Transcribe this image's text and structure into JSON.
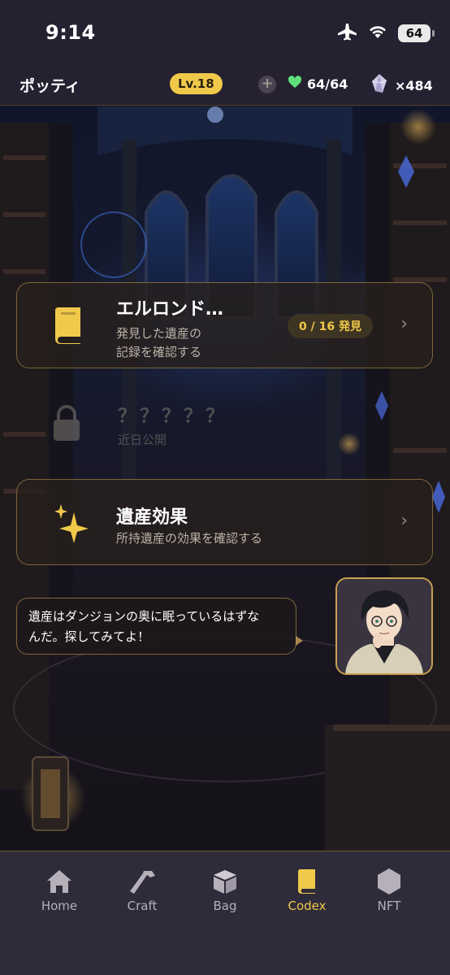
{
  "status_bar": {
    "time": "9:14",
    "battery": "64",
    "icons": [
      "airplane-mode-icon",
      "wifi-icon",
      "battery-icon"
    ]
  },
  "header": {
    "player_name": "ポッティ",
    "level": "Lv.18",
    "hearts": "64/64",
    "gems": "×484",
    "colors": {
      "level_badge": "#f0c94a",
      "heart": "#5fe07a"
    }
  },
  "menu": {
    "codex": {
      "title": "エルロンド…",
      "subtitle_line1": "発見した遺産の",
      "subtitle_line2": "記録を確認する",
      "progress": "0 / 16 発見"
    },
    "locked": {
      "title": "？？？？？",
      "subtitle": "近日公開"
    },
    "effects": {
      "title": "遺産効果",
      "subtitle": "所持遺産の効果を確認する"
    }
  },
  "dialogue": {
    "line1": "遺産はダンジョンの奥に眠っているはずな",
    "line2": "んだ。探してみてよ！"
  },
  "tabs": [
    {
      "label": "Home",
      "icon": "home-icon",
      "active": false
    },
    {
      "label": "Craft",
      "icon": "hammer-icon",
      "active": false
    },
    {
      "label": "Bag",
      "icon": "box-icon",
      "active": false
    },
    {
      "label": "Codex",
      "icon": "book-icon",
      "active": true
    },
    {
      "label": "NFT",
      "icon": "hexagon-icon",
      "active": false
    }
  ],
  "accent_color": "#f0c94a"
}
